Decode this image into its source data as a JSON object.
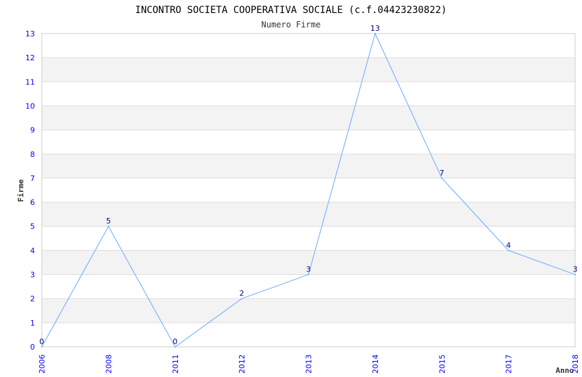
{
  "chart_data": {
    "type": "line",
    "title": "INCONTRO SOCIETA COOPERATIVA SOCIALE (c.f.04423230822)",
    "subtitle": "Numero Firme",
    "xlabel": "Anno",
    "ylabel": "Firme",
    "categories": [
      "2006",
      "2008",
      "2011",
      "2012",
      "2013",
      "2014",
      "2015",
      "2017",
      "2018"
    ],
    "values": [
      0,
      5,
      0,
      2,
      3,
      13,
      7,
      4,
      3
    ],
    "ylim": [
      0,
      13
    ],
    "yticks": [
      0,
      1,
      2,
      3,
      4,
      5,
      6,
      7,
      8,
      9,
      10,
      11,
      12,
      13
    ],
    "grid": true,
    "legend": "none",
    "colors": {
      "line": "#66aaff",
      "band": "#f3f3f3",
      "tick": "#0000ff",
      "label": "#000080"
    }
  }
}
